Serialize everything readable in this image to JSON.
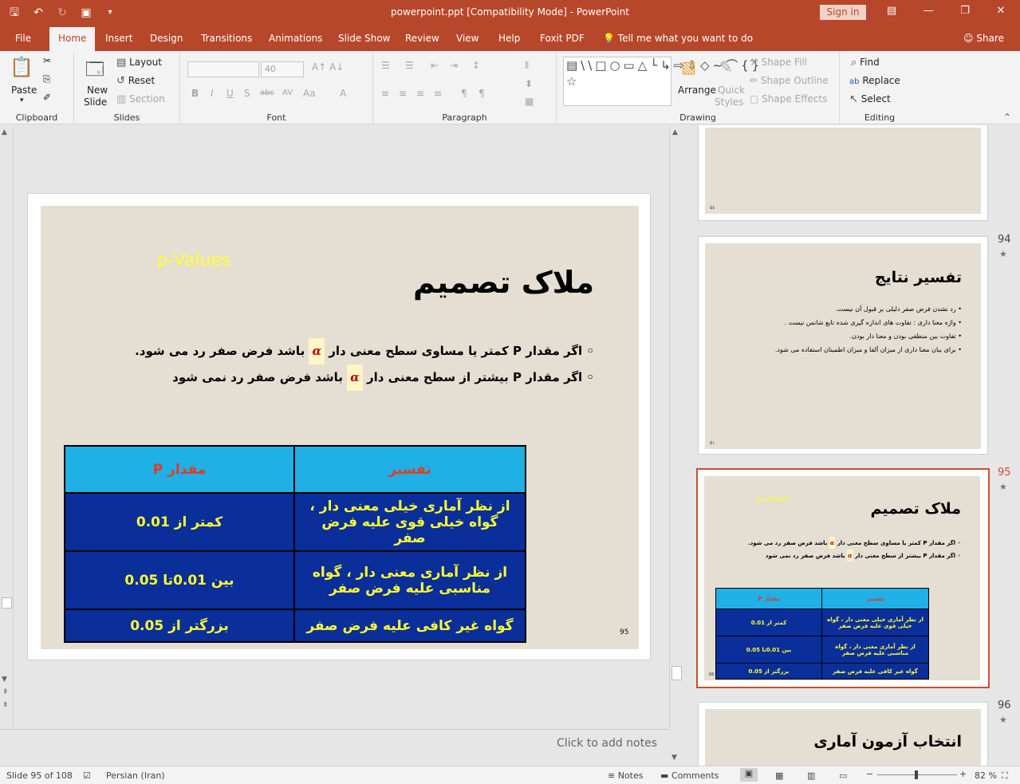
{
  "window": {
    "title": "powerpoint.ppt [Compatibility Mode]  -  PowerPoint",
    "sign_in": "Sign in"
  },
  "tabs": [
    "File",
    "Home",
    "Insert",
    "Design",
    "Transitions",
    "Animations",
    "Slide Show",
    "Review",
    "View",
    "Help",
    "Foxit PDF"
  ],
  "tell_me": "Tell me what you want to do",
  "share": "Share",
  "ribbon": {
    "clipboard": {
      "label": "Clipboard",
      "paste": "Paste"
    },
    "slides": {
      "label": "Slides",
      "new_slide_1": "New",
      "new_slide_2": "Slide",
      "layout": "Layout",
      "reset": "Reset",
      "section": "Section"
    },
    "font": {
      "label": "Font",
      "size": "40"
    },
    "paragraph": {
      "label": "Paragraph"
    },
    "drawing": {
      "label": "Drawing",
      "arrange": "Arrange",
      "quick_1": "Quick",
      "quick_2": "Styles",
      "shape_fill": "Shape Fill",
      "shape_outline": "Shape Outline",
      "shape_effects": "Shape Effects"
    },
    "editing": {
      "label": "Editing",
      "find": "Find",
      "replace": "Replace",
      "select": "Select"
    }
  },
  "slide": {
    "pvalues": "p-Values",
    "title": "ملاک تصمیم",
    "bullet1_a": "اگر مقدار P کمتر یا مساوی سطح معنی دار",
    "bullet1_b": "باشد فرض صفر رد می شود.",
    "bullet2_a": "اگر مقدار P بیشتر از سطح معنی دار",
    "bullet2_b": "باشد فرض صفر رد نمی شود",
    "alpha": "α",
    "table": {
      "headers": [
        "تفسیر",
        "مقدار P"
      ],
      "rows": [
        [
          "از نظر آماری خیلی معنی دار ، گواه خیلی قوی علیه فرض صفر",
          "کمتر از 0.01"
        ],
        [
          "از نظر آماری معنی دار ، گواه مناسبی علیه فرض صفر",
          "بین 0.01تا 0.05"
        ],
        [
          "گواه غیر کافی علیه فرض صفر",
          "بزرگتر از 0.05"
        ]
      ]
    },
    "number": "95"
  },
  "notes_placeholder": "Click to add notes",
  "thumbnails": {
    "prev_number": "٥٤",
    "t94": {
      "number": "94",
      "title": "تفسیر نتایج",
      "lines": [
        "رد نشدن فرض صفر دلیلی بر قبول آن نیست.",
        "واژه معنا داری : تفاوت های اندازه گیری شده تابع شانس نیست .",
        "تفاوت بین منطقی بودن و معنا دار بودن.",
        "برای بیان معنا داری از میزان آلفا و میزان اطمینان استفاده می شود."
      ],
      "page": "٥١"
    },
    "t95": {
      "number": "95",
      "page": "٥٥"
    },
    "t96": {
      "number": "96",
      "title": "انتخاب آزمون آماری"
    },
    "star": "★"
  },
  "status": {
    "slide_info": "Slide 95 of 108",
    "language": "Persian (Iran)",
    "notes": "Notes",
    "comments": "Comments",
    "zoom": "82 %",
    "minus": "−",
    "plus": "+"
  }
}
